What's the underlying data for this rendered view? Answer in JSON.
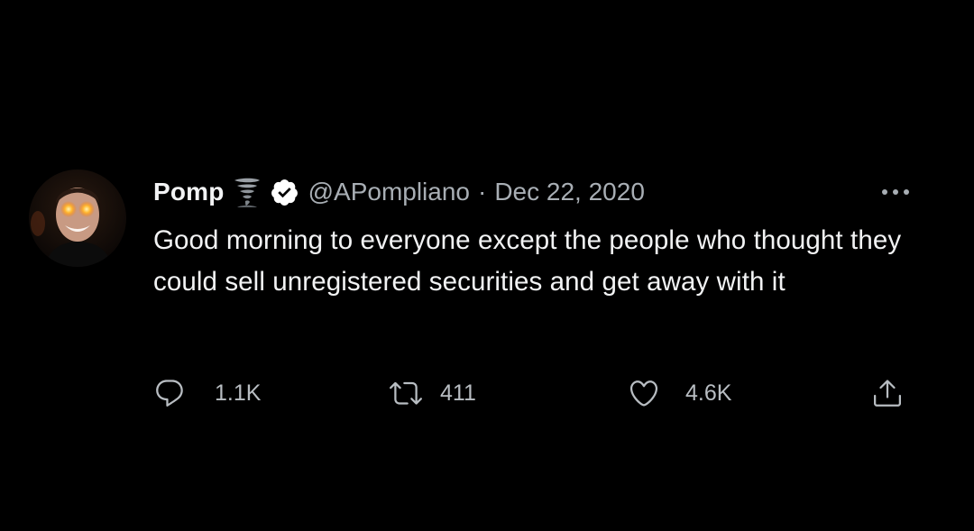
{
  "tweet": {
    "display_name": "Pomp",
    "name_emoji_icon": "tornado-icon",
    "verified_icon": "verified-badge-icon",
    "handle": "@APompliano",
    "separator": "·",
    "date": "Dec 22, 2020",
    "more_icon": "more-options-icon",
    "text": "Good morning to everyone except the people who thought they could sell unregistered securities and get away with it"
  },
  "actions": {
    "reply": {
      "icon": "reply-icon",
      "count": "1.1K"
    },
    "retweet": {
      "icon": "retweet-icon",
      "count": "411"
    },
    "like": {
      "icon": "heart-icon",
      "count": "4.6K"
    },
    "share": {
      "icon": "share-icon"
    }
  },
  "colors": {
    "background": "#000000",
    "primary_text": "#f2f3f4",
    "secondary_text": "#a8aeb4",
    "verified_badge": "#ffffff"
  }
}
